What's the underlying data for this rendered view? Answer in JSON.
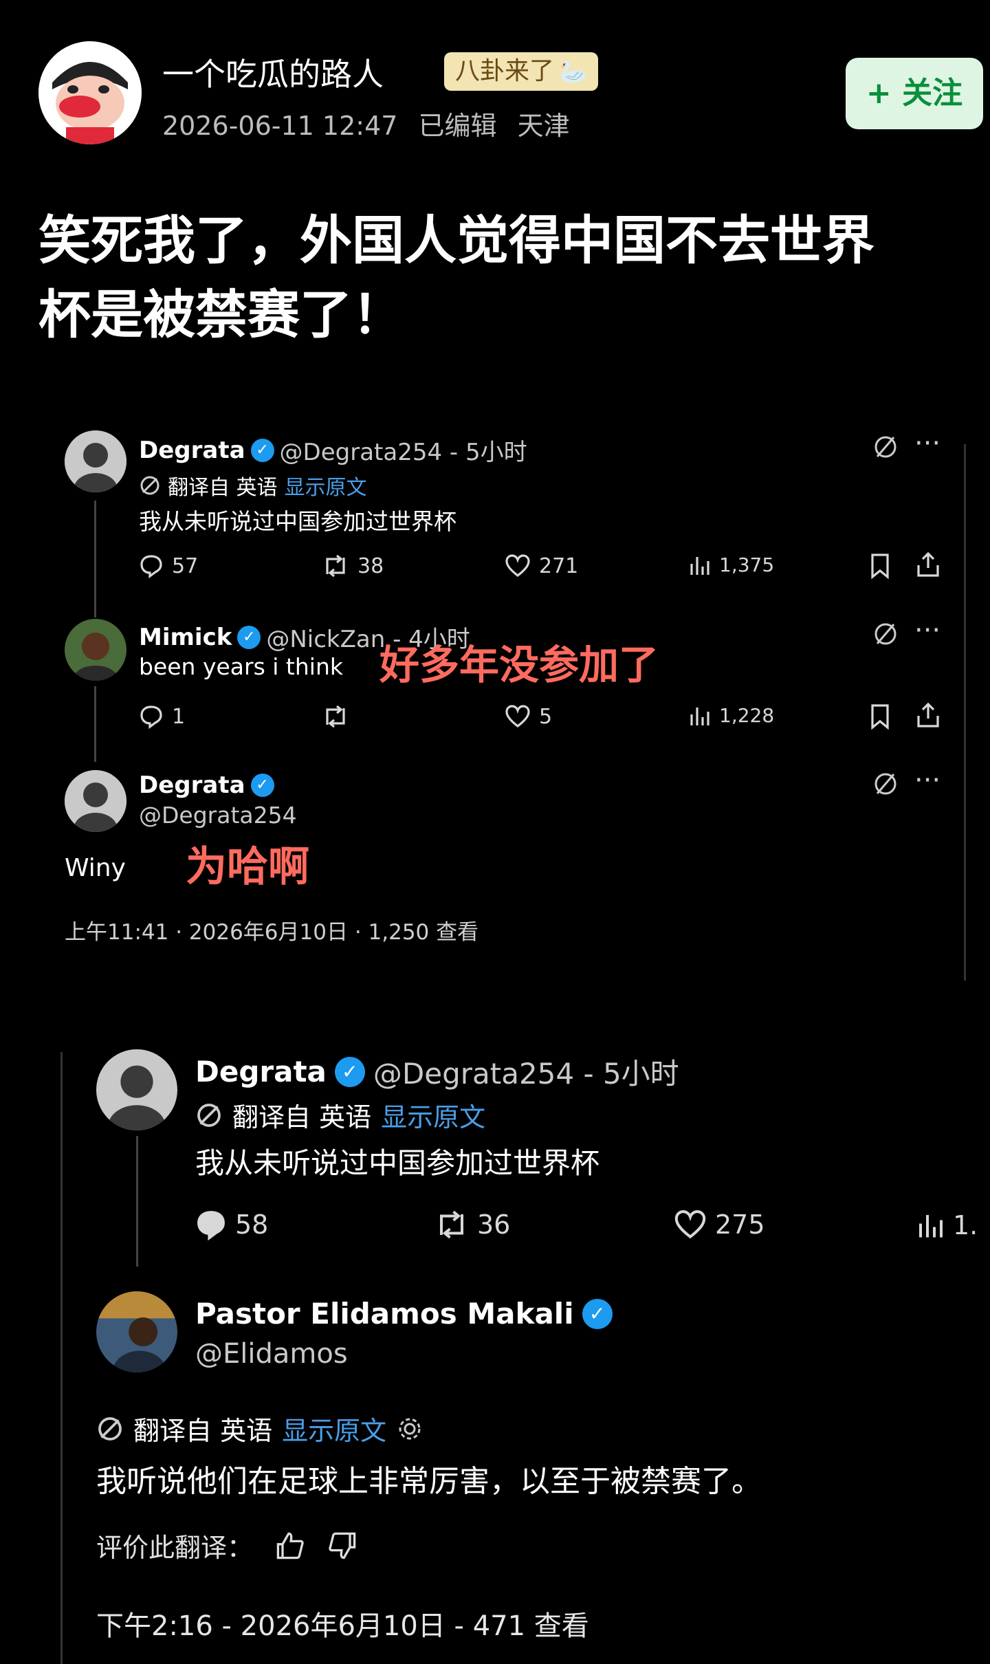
{
  "post": {
    "author": "一个吃瓜的路人",
    "badge": "八卦来了",
    "meta_time": "2026-06-11 12:47",
    "meta_edited": "已编辑",
    "meta_location": "天津",
    "follow_label": "+ 关注",
    "title_line1": "笑死我了，外国人觉得中国不去世界",
    "title_line2": "杯是被禁赛了！"
  },
  "shot1": {
    "tweet1": {
      "name": "Degrata",
      "handle": "@Degrata254 - 5小时",
      "translated_from": "翻译自 英语",
      "show_original": "显示原文",
      "text": "我从未听说过中国参加过世界杯",
      "replies": "57",
      "retweets": "38",
      "likes": "271",
      "views": "1,375"
    },
    "tweet2": {
      "name": "Mimick",
      "handle": "@NickZan - 4小时",
      "text": "been years i think",
      "overlay": "好多年没参加了",
      "replies": "1",
      "retweets": "",
      "likes": "5",
      "views": "1,228"
    },
    "tweet3": {
      "name": "Degrata",
      "handle": "@Degrata254",
      "text": "Winy",
      "overlay": "为哈啊",
      "footer": "上午11:41 · 2026年6月10日 · 1,250 查看"
    }
  },
  "shot2": {
    "tweet1": {
      "name": "Degrata",
      "handle": "@Degrata254 - 5小时",
      "translated_from": "翻译自 英语",
      "show_original": "显示原文",
      "text": "我从未听说过中国参加过世界杯",
      "replies": "58",
      "retweets": "36",
      "likes": "275",
      "views": "1."
    },
    "tweet2": {
      "name": "Pastor Elidamos Makali",
      "handle": "@Elidamos",
      "translated_from": "翻译自 英语",
      "show_original": "显示原文",
      "text": "我听说他们在足球上非常厉害，以至于被禁赛了。",
      "rate_label": "评价此翻译：",
      "footer": "下午2:16 - 2026年6月10日 - 471 查看"
    }
  }
}
